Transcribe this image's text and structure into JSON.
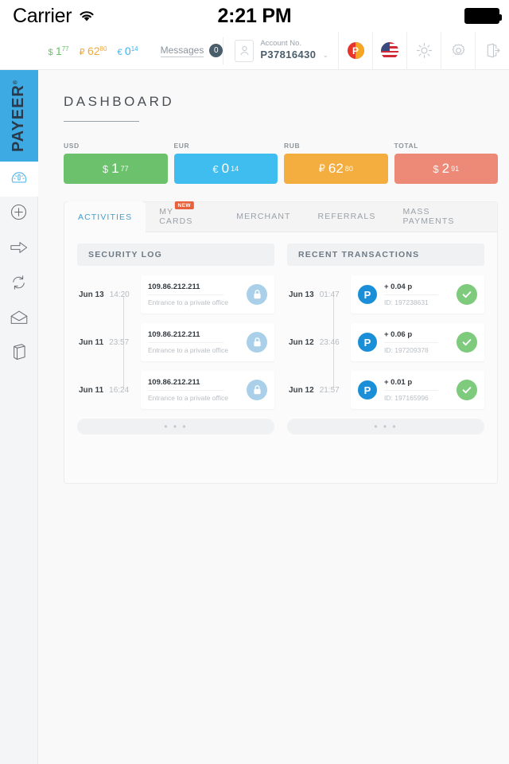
{
  "status_bar": {
    "carrier": "Carrier",
    "wifi_icon": "wifi-icon",
    "time": "2:21 PM",
    "battery_icon": "battery-full-icon"
  },
  "toolbar": {
    "balances": [
      {
        "name": "usd",
        "symbol": "$",
        "integer": "1",
        "fraction": "77",
        "color": "#63c363"
      },
      {
        "name": "rub",
        "symbol": "₽",
        "integer": "62",
        "fraction": "80",
        "color": "#f2a93b"
      },
      {
        "name": "eur",
        "symbol": "€",
        "integer": "0",
        "fraction": "14",
        "color": "#3bb4ea"
      }
    ],
    "messages_label": "Messages",
    "messages_count": "0",
    "account_label": "Account No.",
    "account_number": "P37816430",
    "account_caret": "⌄",
    "icons": [
      "payeer-coin-icon",
      "flag-us-icon",
      "brightness-icon",
      "gear-icon",
      "logout-icon"
    ]
  },
  "sidebar": {
    "logo": {
      "part1": "PAY",
      "part2": "EER",
      "mark": "®"
    },
    "items": [
      {
        "name": "sidebar-item-dashboard",
        "icon": "gauge-icon",
        "active": true
      },
      {
        "name": "sidebar-item-deposit",
        "icon": "plus-circle-icon",
        "active": false
      },
      {
        "name": "sidebar-item-transfer",
        "icon": "arrow-right-icon",
        "active": false
      },
      {
        "name": "sidebar-item-exchange",
        "icon": "refresh-icon",
        "active": false
      },
      {
        "name": "sidebar-item-mail",
        "icon": "envelope-icon",
        "active": false
      },
      {
        "name": "sidebar-item-history",
        "icon": "book-icon",
        "active": false
      }
    ]
  },
  "main": {
    "page_title": "DASHBOARD",
    "currency_cards": [
      {
        "label": "USD",
        "symbol": "$",
        "integer": "1",
        "fraction": "77",
        "color": "#6cc26c"
      },
      {
        "label": "EUR",
        "symbol": "€",
        "integer": "0",
        "fraction": "14",
        "color": "#3fbdef"
      },
      {
        "label": "RUB",
        "symbol": "₽",
        "integer": "62",
        "fraction": "80",
        "color": "#f4ad3f"
      },
      {
        "label": "TOTAL",
        "symbol": "$",
        "integer": "2",
        "fraction": "91",
        "color": "#ec8977"
      }
    ],
    "tabs": [
      {
        "label": "ACTIVITIES",
        "active": true,
        "badge": null
      },
      {
        "label": "MY CARDS",
        "active": false,
        "badge": "NEW"
      },
      {
        "label": "MERCHANT",
        "active": false,
        "badge": null
      },
      {
        "label": "REFERRALS",
        "active": false,
        "badge": null
      },
      {
        "label": "MASS PAYMENTS",
        "active": false,
        "badge": null
      }
    ],
    "security_log": {
      "title": "SECURITY LOG",
      "more_label": "• • •",
      "rows": [
        {
          "day": "Jun 13",
          "time": "14:20",
          "title": "109.86.212.211",
          "subtitle": "Entrance to a private office",
          "icon": "lock-icon"
        },
        {
          "day": "Jun 11",
          "time": "23:57",
          "title": "109.86.212.211",
          "subtitle": "Entrance to a private office",
          "icon": "lock-icon"
        },
        {
          "day": "Jun 11",
          "time": "16:24",
          "title": "109.86.212.211",
          "subtitle": "Entrance to a private office",
          "icon": "lock-icon"
        }
      ]
    },
    "recent_transactions": {
      "title": "RECENT TRANSACTIONS",
      "more_label": "• • •",
      "rows": [
        {
          "day": "Jun 13",
          "time": "01:47",
          "logo": "P",
          "title": "+ 0.04 p",
          "subtitle": "ID: 197238631",
          "icon": "check-icon"
        },
        {
          "day": "Jun 12",
          "time": "23:46",
          "logo": "P",
          "title": "+ 0.06 p",
          "subtitle": "ID: 197209378",
          "icon": "check-icon"
        },
        {
          "day": "Jun 12",
          "time": "21:57",
          "logo": "P",
          "title": "+ 0.01 p",
          "subtitle": "ID: 197165996",
          "icon": "check-icon"
        }
      ]
    }
  }
}
